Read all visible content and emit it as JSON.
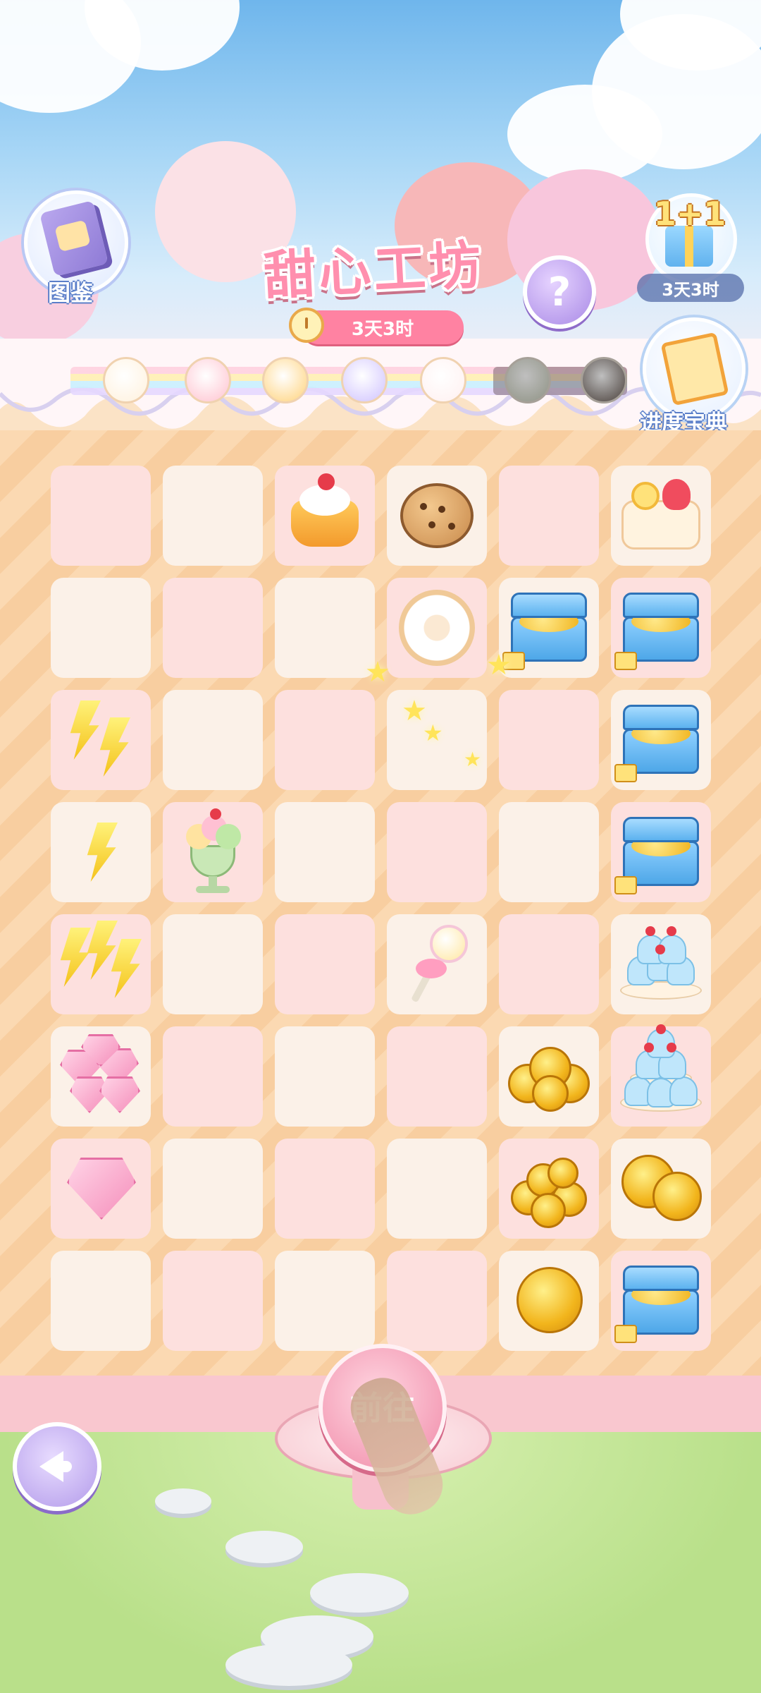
{
  "header": {
    "title": "甜心工坊",
    "event_timer": "3天3时",
    "help_symbol": "?",
    "collection_label": "图鉴",
    "gift_label": "1+1",
    "gift_timer": "3天3时",
    "guide_label": "进度宝典"
  },
  "progress": {
    "desserts": [
      "donut",
      "macaron",
      "pudding",
      "blueberry-cake",
      "strawberry-roll",
      "matcha-cake",
      "chocolate-cake"
    ],
    "unlocked_count": 5
  },
  "board": {
    "columns": 6,
    "rows": 8,
    "cells": [
      [
        {
          "bg": "p",
          "item": ""
        },
        {
          "bg": "w",
          "item": ""
        },
        {
          "bg": "p",
          "item": "pudding"
        },
        {
          "bg": "w",
          "item": "cookie"
        },
        {
          "bg": "p",
          "item": ""
        },
        {
          "bg": "w",
          "item": "roll-cake"
        }
      ],
      [
        {
          "bg": "w",
          "item": ""
        },
        {
          "bg": "p",
          "item": ""
        },
        {
          "bg": "w",
          "item": ""
        },
        {
          "bg": "p",
          "item": "donut"
        },
        {
          "bg": "w",
          "item": "treasure-chest"
        },
        {
          "bg": "p",
          "item": "treasure-chest"
        }
      ],
      [
        {
          "bg": "p",
          "item": "energy-bolt-2"
        },
        {
          "bg": "w",
          "item": ""
        },
        {
          "bg": "p",
          "item": ""
        },
        {
          "bg": "w",
          "item": ""
        },
        {
          "bg": "p",
          "item": ""
        },
        {
          "bg": "w",
          "item": "treasure-chest"
        }
      ],
      [
        {
          "bg": "w",
          "item": "energy-bolt-1"
        },
        {
          "bg": "p",
          "item": "sundae"
        },
        {
          "bg": "w",
          "item": ""
        },
        {
          "bg": "p",
          "item": ""
        },
        {
          "bg": "w",
          "item": ""
        },
        {
          "bg": "p",
          "item": "treasure-chest"
        }
      ],
      [
        {
          "bg": "p",
          "item": "energy-bolt-3"
        },
        {
          "bg": "w",
          "item": ""
        },
        {
          "bg": "p",
          "item": ""
        },
        {
          "bg": "w",
          "item": "lollipop"
        },
        {
          "bg": "p",
          "item": ""
        },
        {
          "bg": "w",
          "item": "cupcake-plate"
        }
      ],
      [
        {
          "bg": "w",
          "item": "gems-many"
        },
        {
          "bg": "p",
          "item": ""
        },
        {
          "bg": "w",
          "item": ""
        },
        {
          "bg": "p",
          "item": ""
        },
        {
          "bg": "w",
          "item": "coin-stack"
        },
        {
          "bg": "p",
          "item": "cupcake-tower"
        }
      ],
      [
        {
          "bg": "p",
          "item": "gem-single"
        },
        {
          "bg": "w",
          "item": ""
        },
        {
          "bg": "p",
          "item": ""
        },
        {
          "bg": "w",
          "item": ""
        },
        {
          "bg": "p",
          "item": "coin-pile"
        },
        {
          "bg": "w",
          "item": "coin-pair"
        }
      ],
      [
        {
          "bg": "w",
          "item": ""
        },
        {
          "bg": "p",
          "item": ""
        },
        {
          "bg": "w",
          "item": ""
        },
        {
          "bg": "p",
          "item": ""
        },
        {
          "bg": "w",
          "item": "coin-single"
        },
        {
          "bg": "p",
          "item": "treasure-chest"
        }
      ]
    ]
  },
  "footer": {
    "go_button_label": "前往",
    "back_icon": "back-arrow-icon"
  },
  "colors": {
    "title_pink": "#ff8fae",
    "cell_pink": "#fde0de",
    "cell_cream": "#fbf1e8",
    "pill_pink": "#ff82a2"
  }
}
